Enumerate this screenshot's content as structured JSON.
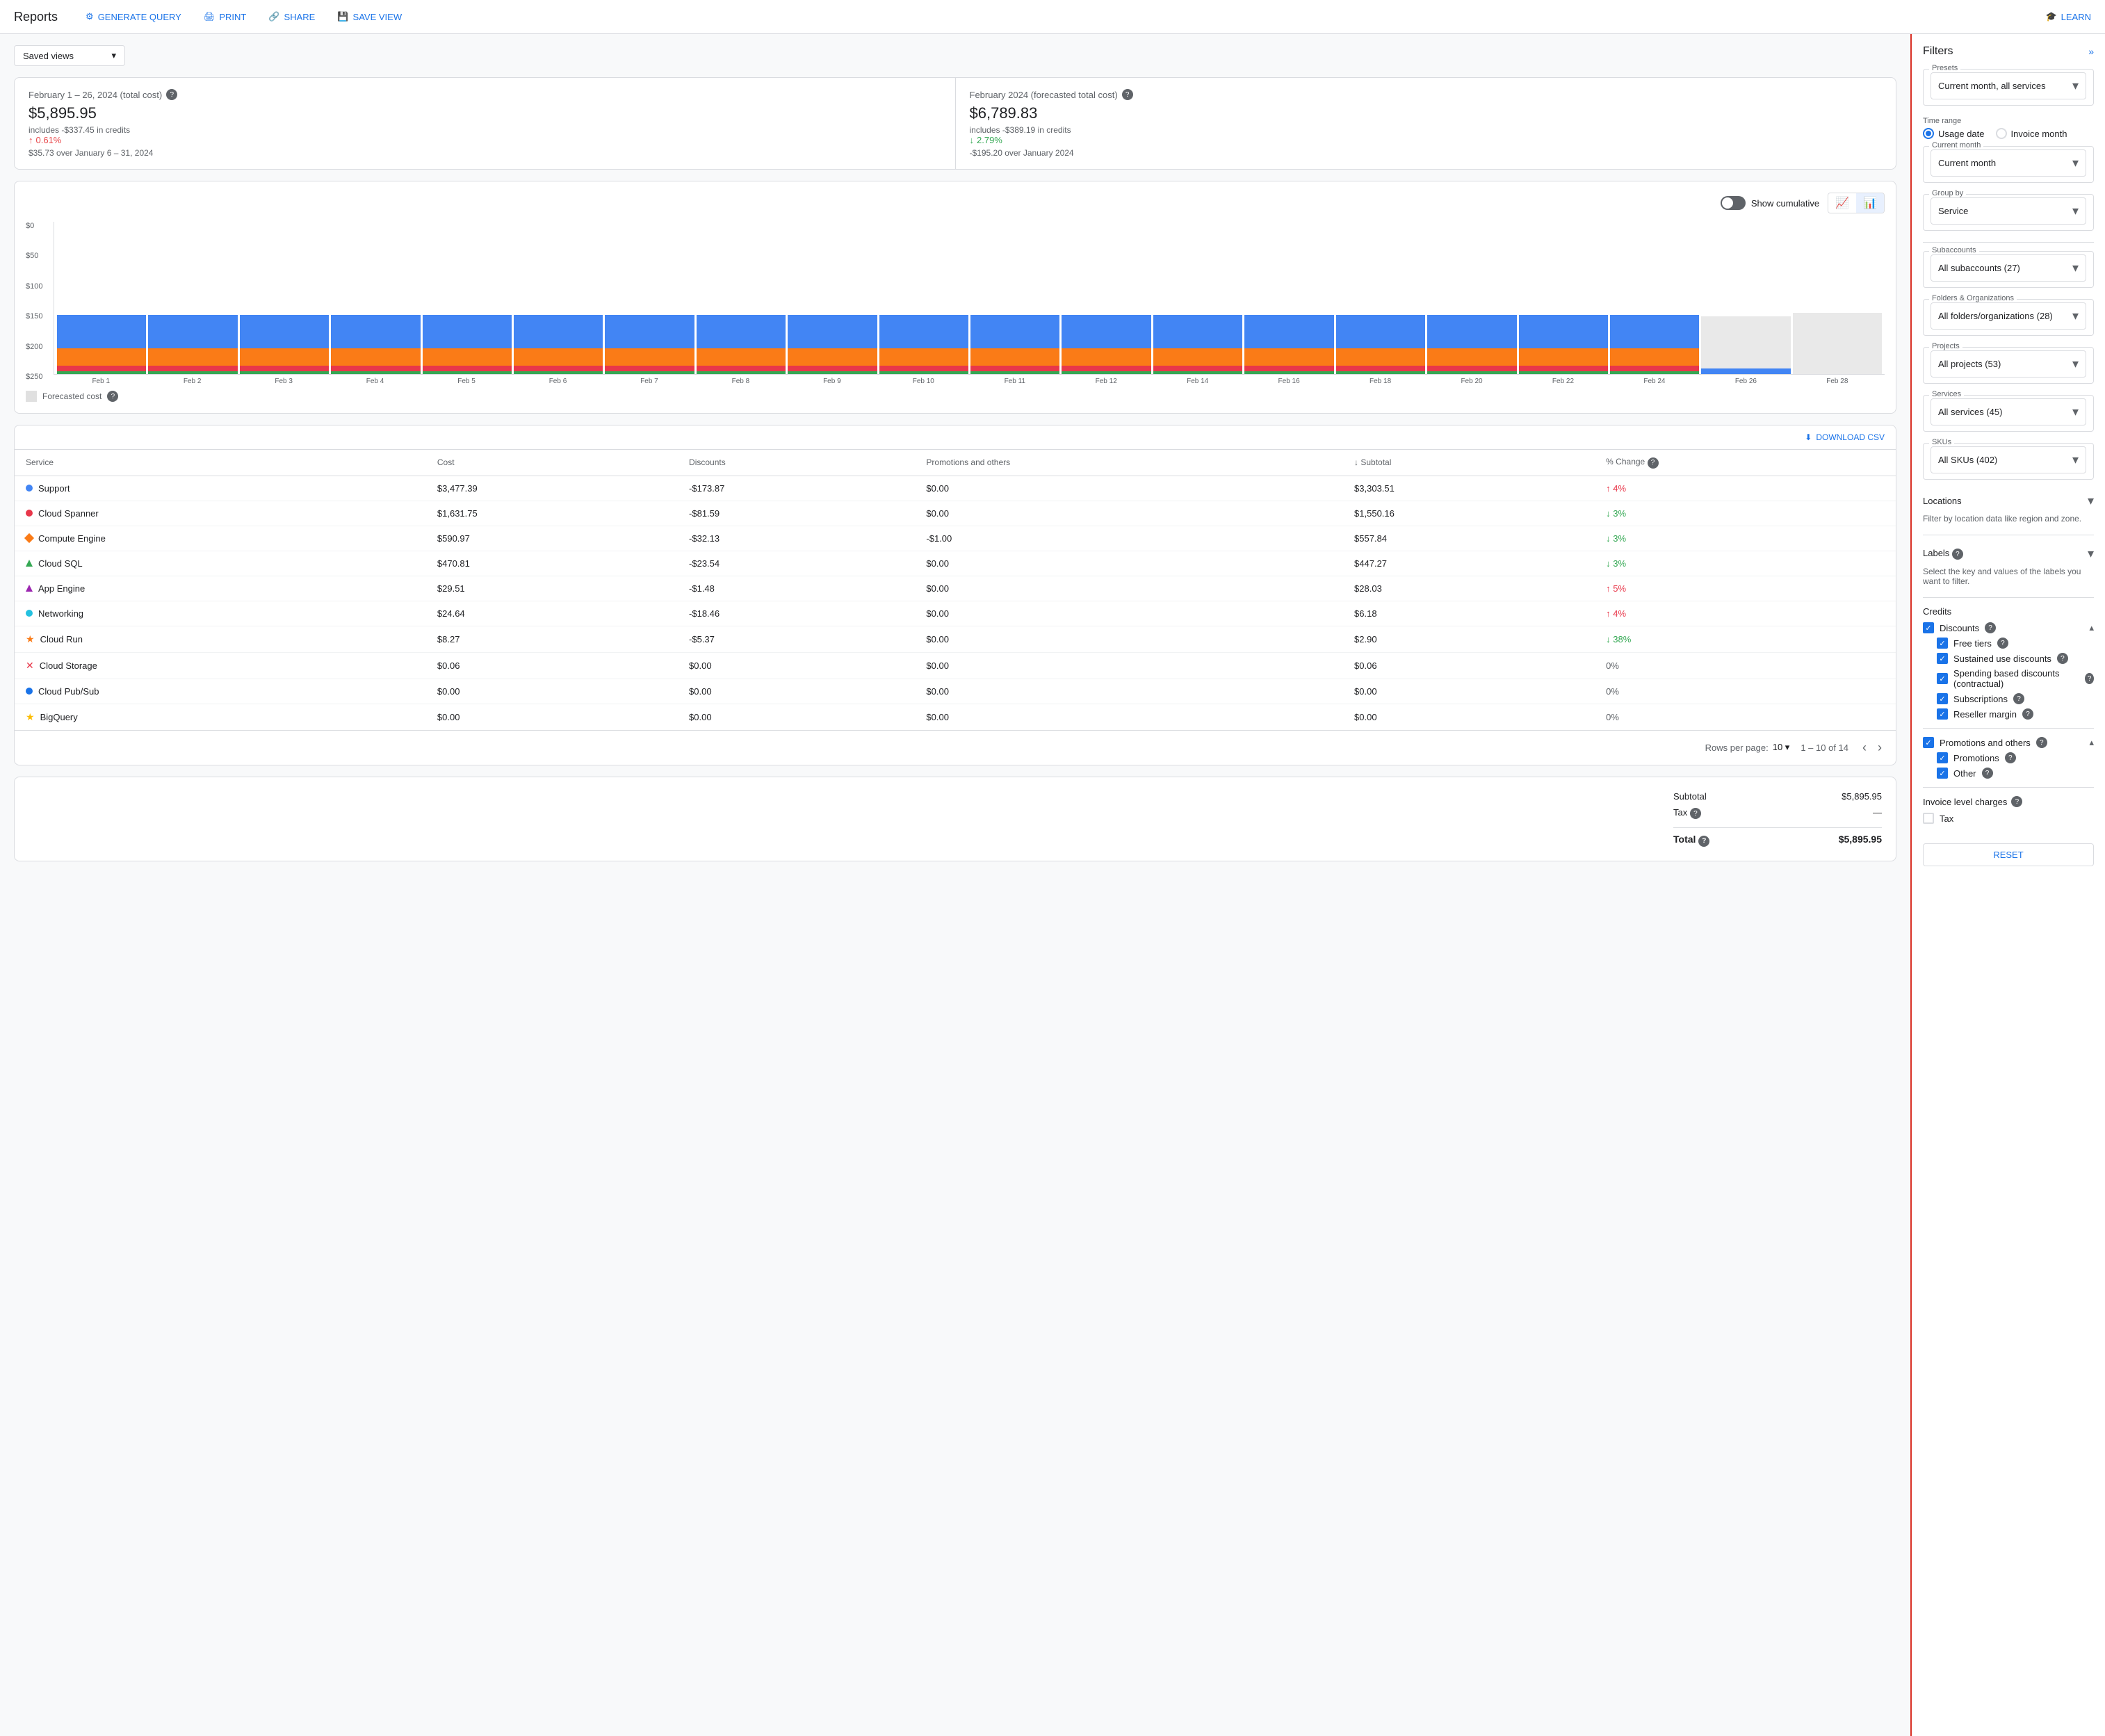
{
  "header": {
    "title": "Reports",
    "actions": [
      {
        "id": "generate-query",
        "label": "GENERATE QUERY",
        "icon": "⚙"
      },
      {
        "id": "print",
        "label": "PRINT",
        "icon": "🖨"
      },
      {
        "id": "share",
        "label": "SHARE",
        "icon": "🔗"
      },
      {
        "id": "save-view",
        "label": "SAVE VIEW",
        "icon": "💾"
      }
    ],
    "learn_label": "LEARN",
    "learn_icon": "🎓"
  },
  "saved_views": {
    "label": "Saved views",
    "placeholder": "Saved views"
  },
  "stats": {
    "card1": {
      "title": "February 1 – 26, 2024 (total cost)",
      "value": "$5,895.95",
      "sub": "includes -$337.45 in credits",
      "change_pct": "0.61%",
      "change_dir": "up",
      "change_sub": "$35.73 over January 6 – 31, 2024"
    },
    "card2": {
      "title": "February 2024 (forecasted total cost)",
      "value": "$6,789.83",
      "sub": "includes -$389.19 in credits",
      "change_pct": "2.79%",
      "change_dir": "down",
      "change_sub": "-$195.20 over January 2024"
    }
  },
  "chart": {
    "show_cumulative": "Show cumulative",
    "forecasted_cost": "Forecasted cost",
    "y_labels": [
      "$0",
      "$50",
      "$100",
      "$150",
      "$200",
      "$250"
    ],
    "x_labels": [
      "Feb 1",
      "Feb 2",
      "Feb 3",
      "Feb 4",
      "Feb 5",
      "Feb 6",
      "Feb 7",
      "Feb 8",
      "Feb 9",
      "Feb 10",
      "Feb 11",
      "Feb 12",
      "Feb 14",
      "Feb 16",
      "Feb 18",
      "Feb 20",
      "Feb 22",
      "Feb 24",
      "Feb 26",
      "Feb 28"
    ],
    "bars": [
      {
        "blue": 55,
        "orange": 28,
        "red": 10,
        "green": 4
      },
      {
        "blue": 55,
        "orange": 28,
        "red": 10,
        "green": 4
      },
      {
        "blue": 55,
        "orange": 28,
        "red": 10,
        "green": 4
      },
      {
        "blue": 55,
        "orange": 28,
        "red": 10,
        "green": 4
      },
      {
        "blue": 55,
        "orange": 28,
        "red": 10,
        "green": 4
      },
      {
        "blue": 55,
        "orange": 28,
        "red": 10,
        "green": 4
      },
      {
        "blue": 55,
        "orange": 28,
        "red": 10,
        "green": 4
      },
      {
        "blue": 55,
        "orange": 28,
        "red": 10,
        "green": 4
      },
      {
        "blue": 55,
        "orange": 28,
        "red": 10,
        "green": 4
      },
      {
        "blue": 55,
        "orange": 28,
        "red": 10,
        "green": 4
      },
      {
        "blue": 55,
        "orange": 28,
        "red": 10,
        "green": 4
      },
      {
        "blue": 55,
        "orange": 28,
        "red": 10,
        "green": 4
      },
      {
        "blue": 55,
        "orange": 28,
        "red": 10,
        "green": 4
      },
      {
        "blue": 55,
        "orange": 28,
        "red": 10,
        "green": 4
      },
      {
        "blue": 55,
        "orange": 28,
        "red": 10,
        "green": 4
      },
      {
        "blue": 55,
        "orange": 28,
        "red": 10,
        "green": 4
      },
      {
        "blue": 55,
        "orange": 28,
        "red": 10,
        "green": 4
      },
      {
        "blue": 55,
        "orange": 28,
        "red": 10,
        "green": 4
      },
      {
        "blue": 4,
        "orange": 0,
        "red": 0,
        "green": 0,
        "forecast": 85
      },
      {
        "forecast": 100
      }
    ]
  },
  "table": {
    "download_label": "DOWNLOAD CSV",
    "columns": [
      "Service",
      "Cost",
      "Discounts",
      "Promotions and others",
      "↓ Subtotal",
      "% Change"
    ],
    "rows": [
      {
        "service": "Support",
        "color": "#4285f4",
        "shape": "dot",
        "cost": "$3,477.39",
        "discounts": "-$173.87",
        "promos": "$0.00",
        "subtotal": "$3,303.51",
        "change": "4%",
        "change_dir": "up"
      },
      {
        "service": "Cloud Spanner",
        "color": "#e8374a",
        "shape": "dot",
        "cost": "$1,631.75",
        "discounts": "-$81.59",
        "promos": "$0.00",
        "subtotal": "$1,550.16",
        "change": "3%",
        "change_dir": "down"
      },
      {
        "service": "Compute Engine",
        "color": "#fa7b17",
        "shape": "diamond",
        "cost": "$590.97",
        "discounts": "-$32.13",
        "promos": "-$1.00",
        "subtotal": "$557.84",
        "change": "3%",
        "change_dir": "down"
      },
      {
        "service": "Cloud SQL",
        "color": "#34a853",
        "shape": "triangle",
        "cost": "$470.81",
        "discounts": "-$23.54",
        "promos": "$0.00",
        "subtotal": "$447.27",
        "change": "3%",
        "change_dir": "down"
      },
      {
        "service": "App Engine",
        "color": "#9c27b0",
        "shape": "triangle",
        "cost": "$29.51",
        "discounts": "-$1.48",
        "promos": "$0.00",
        "subtotal": "$28.03",
        "change": "5%",
        "change_dir": "up"
      },
      {
        "service": "Networking",
        "color": "#24c1e0",
        "shape": "dot",
        "cost": "$24.64",
        "discounts": "-$18.46",
        "promos": "$0.00",
        "subtotal": "$6.18",
        "change": "4%",
        "change_dir": "up"
      },
      {
        "service": "Cloud Run",
        "color": "#fa7b17",
        "shape": "star",
        "cost": "$8.27",
        "discounts": "-$5.37",
        "promos": "$0.00",
        "subtotal": "$2.90",
        "change": "38%",
        "change_dir": "down"
      },
      {
        "service": "Cloud Storage",
        "color": "#e8374a",
        "shape": "cross",
        "cost": "$0.06",
        "discounts": "$0.00",
        "promos": "$0.00",
        "subtotal": "$0.06",
        "change": "0%",
        "change_dir": "zero"
      },
      {
        "service": "Cloud Pub/Sub",
        "color": "#1a73e8",
        "shape": "dot",
        "cost": "$0.00",
        "discounts": "$0.00",
        "promos": "$0.00",
        "subtotal": "$0.00",
        "change": "0%",
        "change_dir": "zero"
      },
      {
        "service": "BigQuery",
        "color": "#fbbc04",
        "shape": "star",
        "cost": "$0.00",
        "discounts": "$0.00",
        "promos": "$0.00",
        "subtotal": "$0.00",
        "change": "0%",
        "change_dir": "zero"
      }
    ],
    "pagination": {
      "rows_per_page": "10",
      "range": "1 – 10 of 14"
    }
  },
  "summary": {
    "subtotal_label": "Subtotal",
    "subtotal_value": "$5,895.95",
    "tax_label": "Tax",
    "tax_value": "—",
    "total_label": "Total",
    "total_value": "$5,895.95",
    "tax_help": true
  },
  "filters": {
    "title": "Filters",
    "presets": {
      "label": "Presets",
      "value": "Current month, all services"
    },
    "time_range": {
      "label": "Time range",
      "options": [
        "Usage date",
        "Invoice month"
      ],
      "selected": "Usage date"
    },
    "current_month": {
      "label": "Current month",
      "value": "Current month"
    },
    "group_by": {
      "label": "Group by",
      "value": "Service"
    },
    "subaccounts": {
      "label": "Subaccounts",
      "value": "All subaccounts (27)"
    },
    "folders_orgs": {
      "label": "Folders & Organizations",
      "value": "All folders/organizations (28)"
    },
    "projects": {
      "label": "Projects",
      "value": "All projects (53)"
    },
    "services": {
      "label": "Services",
      "value": "All services (45)"
    },
    "skus": {
      "label": "SKUs",
      "value": "All SKUs (402)"
    },
    "locations": {
      "label": "Locations",
      "sub": "Filter by location data like region and zone."
    },
    "labels": {
      "label": "Labels",
      "sub": "Select the key and values of the labels you want to filter."
    },
    "credits": {
      "label": "Credits",
      "discounts": {
        "label": "Discounts",
        "checked": true,
        "items": [
          {
            "label": "Free tiers",
            "checked": true
          },
          {
            "label": "Sustained use discounts",
            "checked": true
          },
          {
            "label": "Spending based discounts (contractual)",
            "checked": true
          },
          {
            "label": "Subscriptions",
            "checked": true
          },
          {
            "label": "Reseller margin",
            "checked": true
          }
        ]
      },
      "promotions": {
        "label": "Promotions and others",
        "checked": true,
        "items": [
          {
            "label": "Promotions",
            "checked": true
          },
          {
            "label": "Other",
            "checked": true
          }
        ]
      }
    },
    "invoice_charges": {
      "label": "Invoice level charges",
      "tax": {
        "label": "Tax",
        "checked": false
      }
    },
    "reset_label": "RESET"
  }
}
